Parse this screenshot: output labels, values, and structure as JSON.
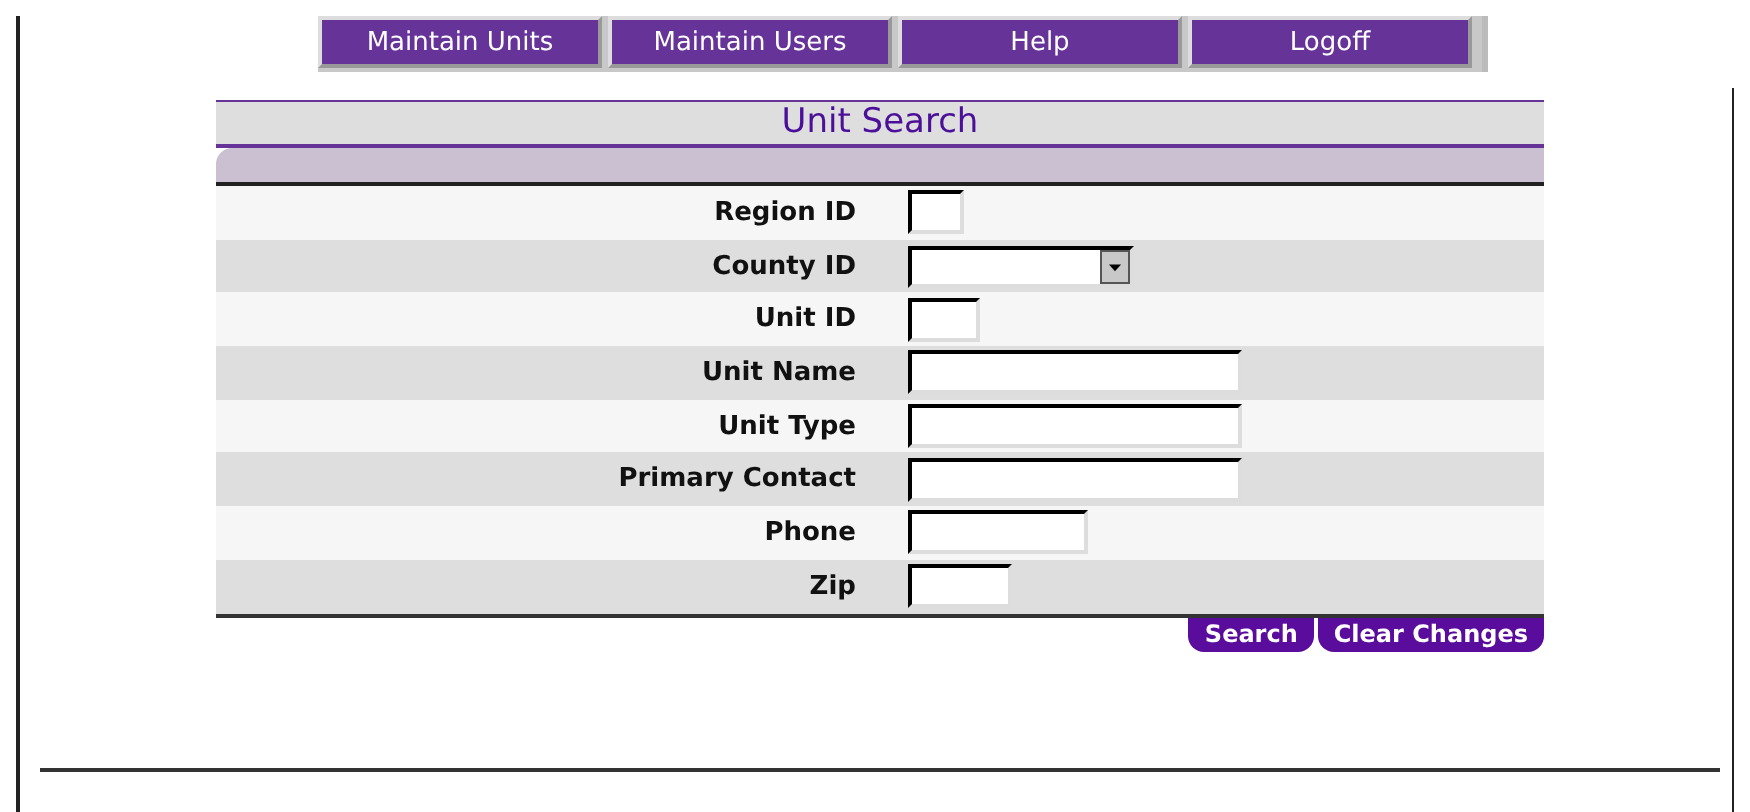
{
  "nav": [
    {
      "label": "Maintain Units"
    },
    {
      "label": "Maintain Users"
    },
    {
      "label": "Help"
    },
    {
      "label": "Logoff"
    }
  ],
  "form": {
    "title": "Unit Search",
    "fields": [
      {
        "label": "Region ID",
        "kind": "text"
      },
      {
        "label": "County ID",
        "kind": "select"
      },
      {
        "label": "Unit ID",
        "kind": "text"
      },
      {
        "label": "Unit Name",
        "kind": "text"
      },
      {
        "label": "Unit Type",
        "kind": "text"
      },
      {
        "label": "Primary Contact",
        "kind": "text"
      },
      {
        "label": "Phone",
        "kind": "text"
      },
      {
        "label": "Zip",
        "kind": "text"
      }
    ],
    "buttons": [
      "Search",
      "Clear Changes"
    ]
  }
}
